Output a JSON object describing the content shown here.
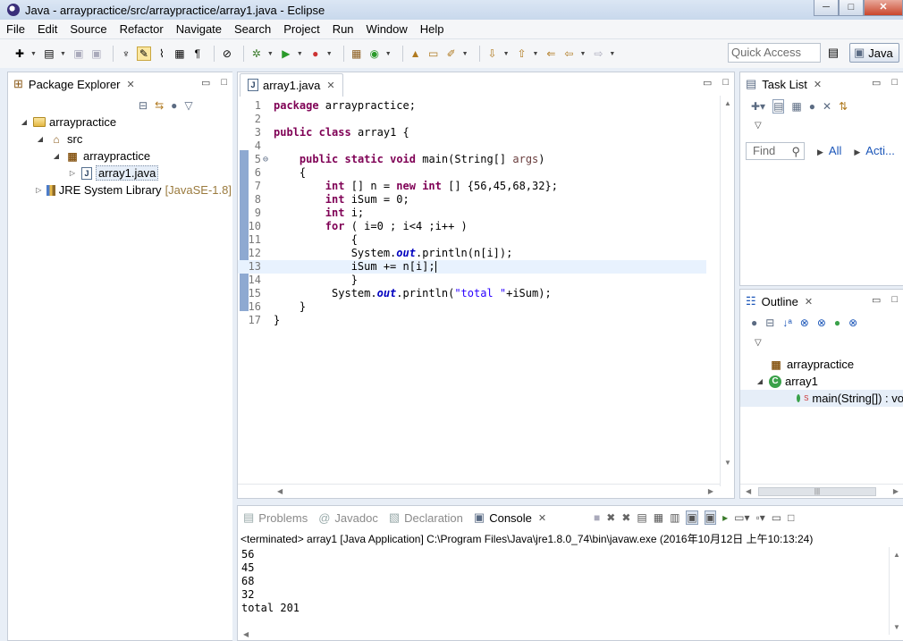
{
  "window": {
    "title": "Java - arraypractice/src/arraypractice/array1.java - Eclipse",
    "minimize": "─",
    "maximize": "□",
    "close": "✕"
  },
  "menu": [
    "File",
    "Edit",
    "Source",
    "Refactor",
    "Navigate",
    "Search",
    "Project",
    "Run",
    "Window",
    "Help"
  ],
  "toolbar": {
    "quick_access_placeholder": "Quick Access",
    "perspective_label": "Java"
  },
  "package_explorer": {
    "tab_label": "Package Explorer",
    "tree": [
      {
        "label": "arraypractice",
        "icon": "project-icon",
        "level": 0,
        "expanded": true
      },
      {
        "label": "src",
        "icon": "source-folder-icon",
        "level": 1,
        "expanded": true
      },
      {
        "label": "arraypractice",
        "icon": "package-icon",
        "level": 2,
        "expanded": true
      },
      {
        "label": "array1.java",
        "icon": "java-file-icon",
        "level": 3,
        "expanded": false,
        "selected": true
      },
      {
        "label": "JRE System Library",
        "suffix": "[JavaSE-1.8]",
        "icon": "library-icon",
        "level": 1,
        "expanded": false
      }
    ]
  },
  "editor": {
    "tab_label": "array1.java",
    "lines": [
      {
        "n": "1",
        "html": "<span class='kw'>package</span> arraypractice;"
      },
      {
        "n": "2",
        "html": ""
      },
      {
        "n": "3",
        "html": "<span class='kw'>public</span> <span class='kw'>class</span> array1 {"
      },
      {
        "n": "4",
        "html": ""
      },
      {
        "n": "5",
        "fold": "⊖",
        "html": "    <span class='kw'>public</span> <span class='kw'>static</span> <span class='kw'>void</span> main(String[] <span class='prm'>args</span>)"
      },
      {
        "n": "6",
        "html": "    {"
      },
      {
        "n": "7",
        "html": "        <span class='kw'>int</span> [] n = <span class='kw'>new</span> <span class='kw'>int</span> [] {56,45,68,32};"
      },
      {
        "n": "8",
        "html": "        <span class='kw'>int</span> iSum = 0;"
      },
      {
        "n": "9",
        "html": "        <span class='kw'>int</span> i;"
      },
      {
        "n": "10",
        "html": "        <span class='kw'>for</span> ( i=0 ; i&lt;4 ;i++ )"
      },
      {
        "n": "11",
        "html": "            {"
      },
      {
        "n": "12",
        "html": "            System.<span class='fld'>out</span>.println(n[i]);"
      },
      {
        "n": "13",
        "html": "            iSum += n[i];<span class='cursor'></span>",
        "current": true
      },
      {
        "n": "14",
        "html": "            }"
      },
      {
        "n": "15",
        "html": "         System.<span class='fld'>out</span>.println(<span class='str'>\"total \"</span>+iSum);"
      },
      {
        "n": "16",
        "html": "    }"
      },
      {
        "n": "17",
        "html": "}"
      }
    ]
  },
  "task_list": {
    "tab_label": "Task List",
    "find_placeholder": "Find",
    "all_label": "All",
    "activate_label": "Acti..."
  },
  "outline": {
    "tab_label": "Outline",
    "items": [
      {
        "label": "arraypractice",
        "icon": "package-icon",
        "level": 0
      },
      {
        "label": "array1",
        "icon": "class-icon",
        "level": 0,
        "expanded": true
      },
      {
        "label": "main(String[]) : vo",
        "icon": "method-icon",
        "level": 1,
        "selected": true
      }
    ]
  },
  "bottom": {
    "tabs": [
      {
        "label": "Problems",
        "active": false
      },
      {
        "label": "Javadoc",
        "active": false
      },
      {
        "label": "Declaration",
        "active": false
      },
      {
        "label": "Console",
        "active": true
      }
    ],
    "console_header": "<terminated> array1 [Java Application] C:\\Program Files\\Java\\jre1.8.0_74\\bin\\javaw.exe (2016年10月12日 上午10:13:24)",
    "output": [
      "56",
      "45",
      "68",
      "32",
      "total 201"
    ]
  },
  "colors": {
    "keyword": "#7f0055",
    "string": "#2a00ff",
    "field": "#0000c0",
    "current_line": "#e8f2fe"
  }
}
